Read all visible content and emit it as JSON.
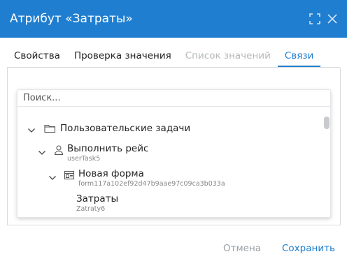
{
  "dialog": {
    "title": "Атрибут «Затраты»"
  },
  "tabs": [
    {
      "label": "Свойства",
      "state": "normal"
    },
    {
      "label": "Проверка значения",
      "state": "normal"
    },
    {
      "label": "Список значений",
      "state": "disabled"
    },
    {
      "label": "Связи",
      "state": "active"
    }
  ],
  "search": {
    "placeholder": "Поиск...",
    "value": ""
  },
  "tree": [
    {
      "label": "Пользовательские задачи",
      "sub": "",
      "icon": "folder-icon",
      "expanded": true
    },
    {
      "label": "Выполнить рейс",
      "sub": "userTask5",
      "icon": "user-icon",
      "expanded": true
    },
    {
      "label": "Новая форма",
      "sub": "form117a102ef92d47b9aae97c09ca3b033a",
      "icon": "form-icon",
      "expanded": true
    },
    {
      "label": "Затраты",
      "sub": "Zatraty6",
      "icon": "",
      "expanded": false
    }
  ],
  "footer": {
    "cancel_label": "Отмена",
    "save_label": "Сохранить"
  },
  "colors": {
    "accent": "#1f7ed0",
    "disabled": "#b5b8bc"
  }
}
